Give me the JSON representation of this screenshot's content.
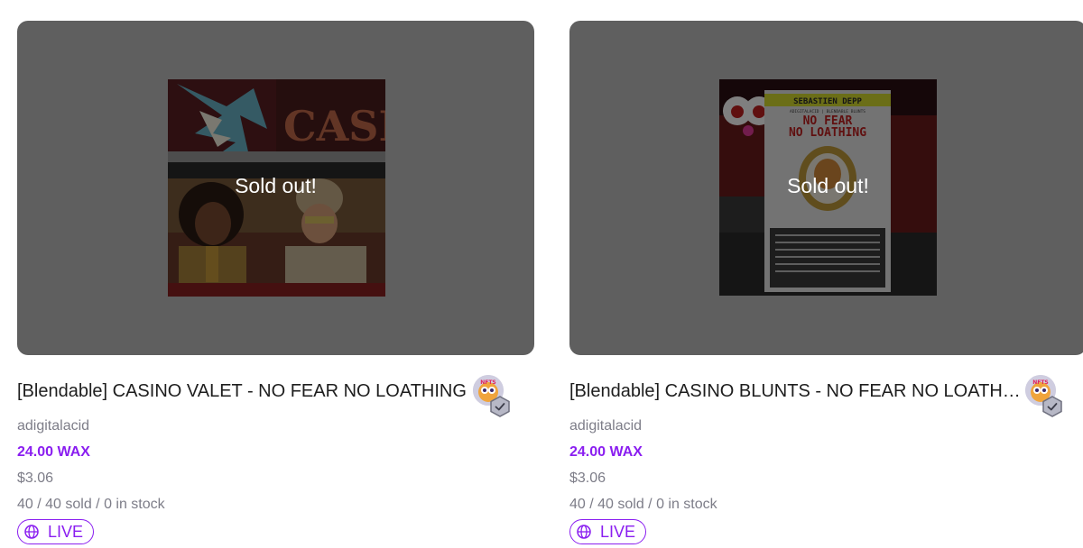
{
  "colors": {
    "accent": "#8a1ef0",
    "muted_text": "#7d7d88",
    "media_background": "#5f5f5f"
  },
  "listings": [
    {
      "title": "[Blendable] CASINO VALET - NO FEAR NO LOATHING",
      "overlay": "Sold out!",
      "artwork_icon": "casino-valet-artwork",
      "avatar_text": "NFTS",
      "collection": "adigitalacid",
      "price": "24.00 WAX",
      "usd": "$3.06",
      "stock": "40 / 40 sold / 0 in stock",
      "status": "LIVE",
      "artwork_text": "CASI"
    },
    {
      "title": "[Blendable] CASINO BLUNTS - NO FEAR NO LOATHING",
      "overlay": "Sold out!",
      "artwork_icon": "casino-blunts-artwork",
      "avatar_text": "NFTS",
      "collection": "adigitalacid",
      "price": "24.00 WAX",
      "usd": "$3.06",
      "stock": "40 / 40 sold / 0 in stock",
      "status": "LIVE",
      "artwork_text": {
        "author": "SEBASTIEN DEPP",
        "series": "ADIGITALACID | BLENDABLE BLUNTS",
        "line1": "NO FEAR",
        "line2": "NO LOATHING"
      }
    }
  ]
}
